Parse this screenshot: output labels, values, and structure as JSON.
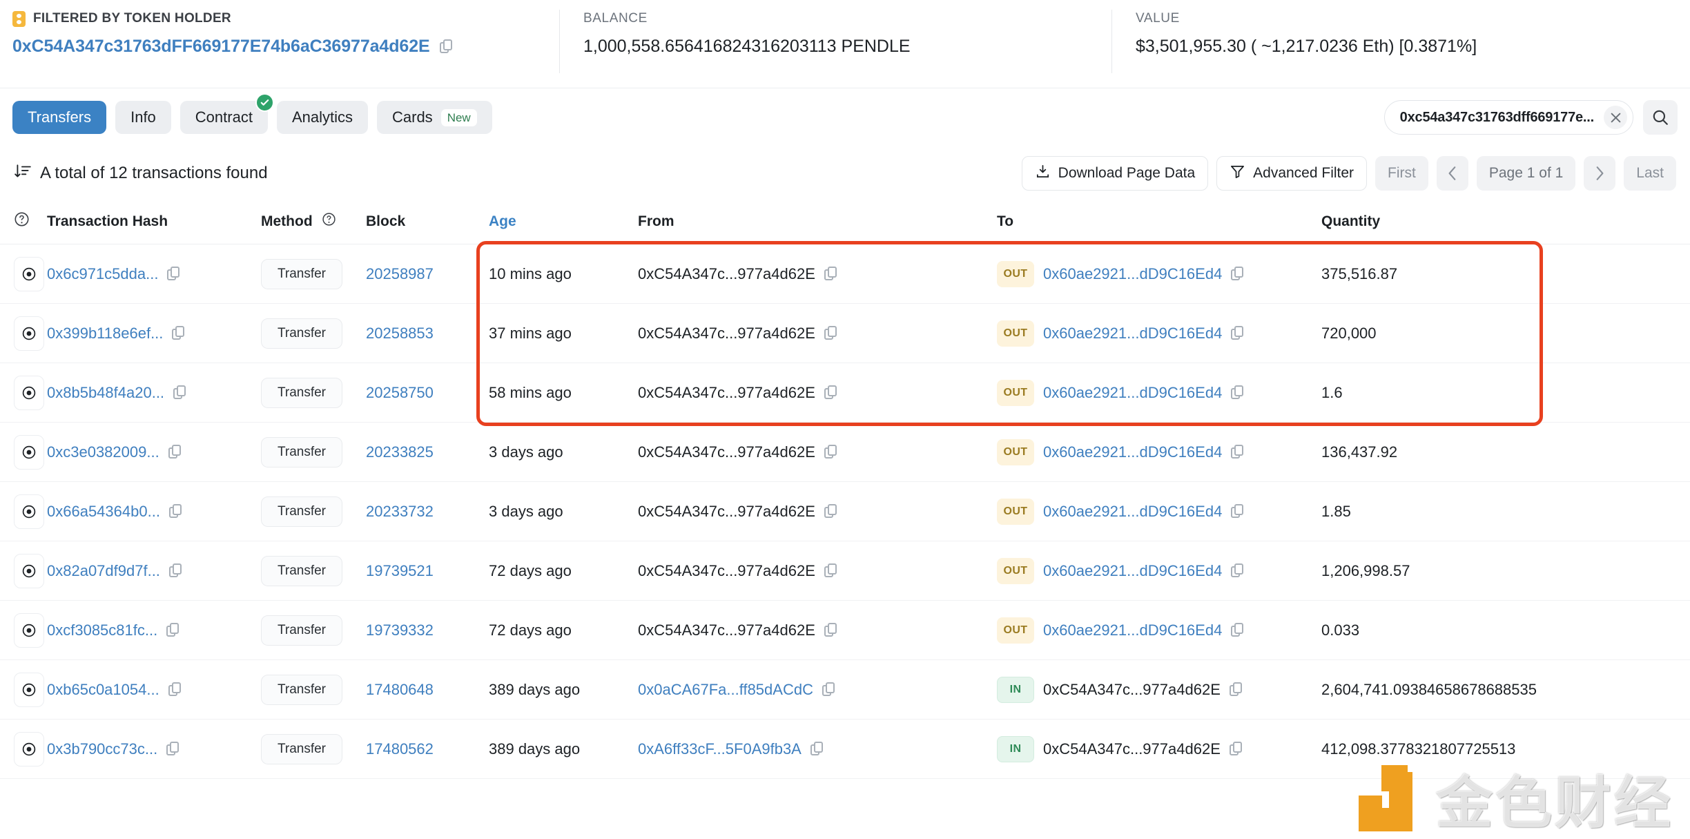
{
  "summary": {
    "filter": {
      "label": "FILTERED BY TOKEN HOLDER",
      "icon": "token-chip-icon",
      "address": "0xC54A347c31763dFF669177E74b6aC36977a4d62E",
      "copy_icon": "copy-icon"
    },
    "balance": {
      "label": "BALANCE",
      "value": "1,000,558.656416824316203113 PENDLE"
    },
    "value": {
      "label": "VALUE",
      "value": "$3,501,955.30 ( ~1,217.0236 Eth) [0.3871%]"
    }
  },
  "tabs": [
    {
      "label": "Transfers",
      "active": true,
      "badge": "",
      "check": false
    },
    {
      "label": "Info",
      "active": false,
      "badge": "",
      "check": false
    },
    {
      "label": "Contract",
      "active": false,
      "badge": "",
      "check": true
    },
    {
      "label": "Analytics",
      "active": false,
      "badge": "",
      "check": false
    },
    {
      "label": "Cards",
      "active": false,
      "badge": "New",
      "check": false
    }
  ],
  "search": {
    "value": "0xc54a347c31763dff669177e...",
    "placeholder": "Search",
    "clear_icon": "close-icon",
    "search_icon": "search-icon"
  },
  "toolbar": {
    "sort_icon": "sort-descending-icon",
    "total_text": "A total of 12 transactions found",
    "download_label": "Download Page Data",
    "download_icon": "download-icon",
    "filter_label": "Advanced Filter",
    "filter_icon": "funnel-icon",
    "first_label": "First",
    "prev_icon": "chevron-left-icon",
    "page_label": "Page 1 of 1",
    "next_icon": "chevron-right-icon",
    "last_label": "Last"
  },
  "table": {
    "headers": {
      "info_icon": "question-circle-icon",
      "hash": "Transaction Hash",
      "method": "Method",
      "method_icon": "question-circle-icon",
      "block": "Block",
      "age": "Age",
      "from": "From",
      "to": "To",
      "quantity": "Quantity"
    },
    "rows": [
      {
        "eye": "eye-icon",
        "hash": "0x6c971c5dda...",
        "method": "Transfer",
        "block": "20258987",
        "age": "10 mins ago",
        "from": "0xC54A347c...977a4d62E",
        "from_link": false,
        "dir": "OUT",
        "to": "0x60ae2921...dD9C16Ed4",
        "to_link": true,
        "quantity": "375,516.87"
      },
      {
        "eye": "eye-icon",
        "hash": "0x399b118e6ef...",
        "method": "Transfer",
        "block": "20258853",
        "age": "37 mins ago",
        "from": "0xC54A347c...977a4d62E",
        "from_link": false,
        "dir": "OUT",
        "to": "0x60ae2921...dD9C16Ed4",
        "to_link": true,
        "quantity": "720,000"
      },
      {
        "eye": "eye-icon",
        "hash": "0x8b5b48f4a20...",
        "method": "Transfer",
        "block": "20258750",
        "age": "58 mins ago",
        "from": "0xC54A347c...977a4d62E",
        "from_link": false,
        "dir": "OUT",
        "to": "0x60ae2921...dD9C16Ed4",
        "to_link": true,
        "quantity": "1.6"
      },
      {
        "eye": "eye-icon",
        "hash": "0xc3e0382009...",
        "method": "Transfer",
        "block": "20233825",
        "age": "3 days ago",
        "from": "0xC54A347c...977a4d62E",
        "from_link": false,
        "dir": "OUT",
        "to": "0x60ae2921...dD9C16Ed4",
        "to_link": true,
        "quantity": "136,437.92"
      },
      {
        "eye": "eye-icon",
        "hash": "0x66a54364b0...",
        "method": "Transfer",
        "block": "20233732",
        "age": "3 days ago",
        "from": "0xC54A347c...977a4d62E",
        "from_link": false,
        "dir": "OUT",
        "to": "0x60ae2921...dD9C16Ed4",
        "to_link": true,
        "quantity": "1.85"
      },
      {
        "eye": "eye-icon",
        "hash": "0x82a07df9d7f...",
        "method": "Transfer",
        "block": "19739521",
        "age": "72 days ago",
        "from": "0xC54A347c...977a4d62E",
        "from_link": false,
        "dir": "OUT",
        "to": "0x60ae2921...dD9C16Ed4",
        "to_link": true,
        "quantity": "1,206,998.57"
      },
      {
        "eye": "eye-icon",
        "hash": "0xcf3085c81fc...",
        "method": "Transfer",
        "block": "19739332",
        "age": "72 days ago",
        "from": "0xC54A347c...977a4d62E",
        "from_link": false,
        "dir": "OUT",
        "to": "0x60ae2921...dD9C16Ed4",
        "to_link": true,
        "quantity": "0.033"
      },
      {
        "eye": "eye-icon",
        "hash": "0xb65c0a1054...",
        "method": "Transfer",
        "block": "17480648",
        "age": "389 days ago",
        "from": "0x0aCA67Fa...ff85dACdC",
        "from_link": true,
        "dir": "IN",
        "to": "0xC54A347c...977a4d62E",
        "to_link": false,
        "quantity": "2,604,741.09384658678688535"
      },
      {
        "eye": "eye-icon",
        "hash": "0x3b790cc73c...",
        "method": "Transfer",
        "block": "17480562",
        "age": "389 days ago",
        "from": "0xA6ff33cF...5F0A9fb3A",
        "from_link": true,
        "dir": "IN",
        "to": "0xC54A347c...977a4d62E",
        "to_link": false,
        "quantity": "412,098.3778321807725513"
      }
    ]
  },
  "annotation": {
    "highlight_box": "red-highlight-box"
  },
  "watermark": {
    "text": "金色财经",
    "logo": "jinse-logo-icon"
  },
  "colors": {
    "accent_blue": "#3b82c4",
    "link_blue": "#3f7fbf",
    "out_badge_bg": "#fdf3dc",
    "out_badge_fg": "#9a7b21",
    "in_badge_bg": "#e5f5ec",
    "in_badge_fg": "#2e8b57",
    "highlight_red": "#e8401f",
    "token_yellow": "#f5b83d"
  }
}
